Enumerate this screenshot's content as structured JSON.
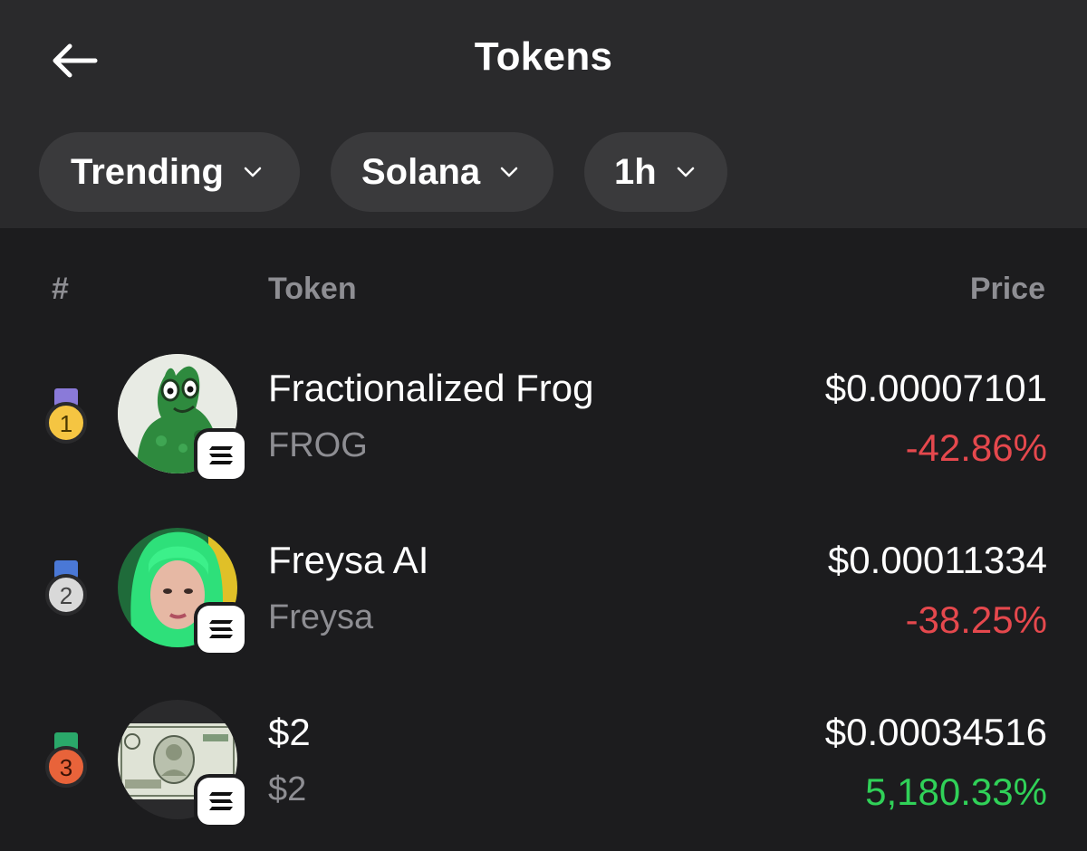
{
  "header": {
    "title": "Tokens"
  },
  "filters": [
    {
      "label": "Trending"
    },
    {
      "label": "Solana"
    },
    {
      "label": "1h"
    }
  ],
  "columns": {
    "rank": "#",
    "token": "Token",
    "price": "Price"
  },
  "tokens": [
    {
      "rank": "1",
      "name": "Fractionalized Frog",
      "symbol": "FROG",
      "price": "$0.00007101",
      "change": "-42.86%",
      "change_color": "#e5484d",
      "medal": "gold",
      "chain_icon": "solana-icon"
    },
    {
      "rank": "2",
      "name": "Freysa AI",
      "symbol": "Freysa",
      "price": "$0.00011334",
      "change": "-38.25%",
      "change_color": "#e5484d",
      "medal": "silver",
      "chain_icon": "solana-icon"
    },
    {
      "rank": "3",
      "name": "$2",
      "symbol": "$2",
      "price": "$0.00034516",
      "change": "5,180.33%",
      "change_color": "#30d158",
      "medal": "bronze",
      "chain_icon": "solana-icon"
    }
  ],
  "colors": {
    "background": "#1c1c1e",
    "topbar": "#2a2a2c",
    "pill": "#3a3a3c",
    "negative": "#e5484d",
    "positive": "#30d158",
    "muted": "#8e8e93"
  }
}
